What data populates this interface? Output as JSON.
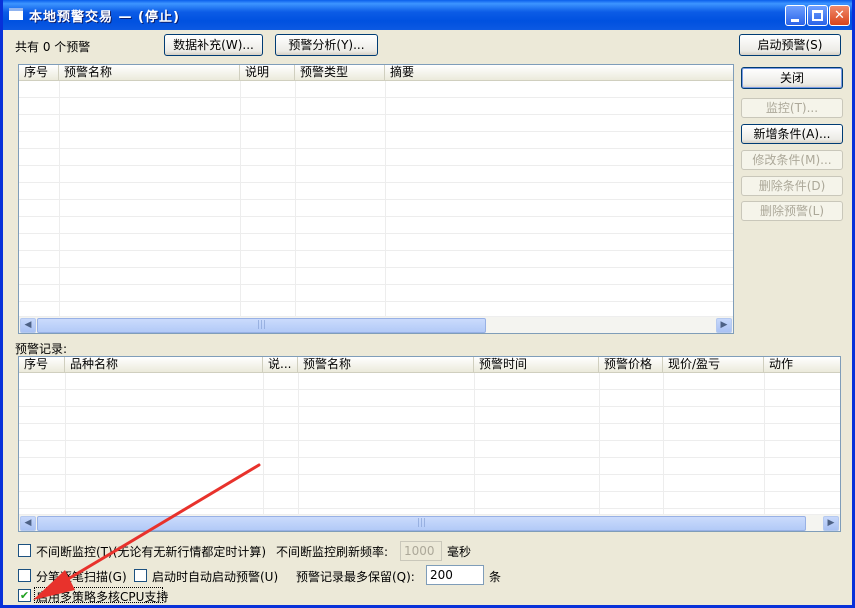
{
  "window": {
    "title": "本地预警交易 — (停止)",
    "min_glyph": "",
    "max_glyph": "",
    "close_glyph": "✕"
  },
  "top": {
    "count_text": "共有 0 个预警",
    "data_fill_button": "数据补充(W)...",
    "analysis_button": "预警分析(Y)...",
    "start_button": "启动预警(S)"
  },
  "side_buttons": {
    "close": "关闭",
    "monitor": "监控(T)...",
    "add_condition": "新增条件(A)...",
    "edit_condition": "修改条件(M)...",
    "delete_condition": "删除条件(D)",
    "delete_alert": "删除预警(L)"
  },
  "alerts_table": {
    "columns": [
      "序号",
      "预警名称",
      "说明",
      "预警类型",
      "摘要"
    ]
  },
  "records": {
    "label": "预警记录:",
    "columns": [
      "序号",
      "品种名称",
      "说...",
      "预警名称",
      "预警时间",
      "预警价格",
      "现价/盈亏",
      "动作"
    ]
  },
  "options": {
    "continuous_monitor": {
      "label": "不间断监控(T)(无论有无新行情都定时计算)",
      "checked": false
    },
    "refresh_label": "不间断监控刷新频率:",
    "refresh_value": "1000",
    "refresh_unit": "毫秒",
    "tick_scan": {
      "label": "分笔逐笔扫描(G)",
      "checked": false
    },
    "auto_start": {
      "label": "启动时自动启动预警(U)",
      "checked": false
    },
    "keep_label": "预警记录最多保留(Q):",
    "keep_value": "200",
    "keep_unit": "条",
    "multicore": {
      "label": "启用多策略多核CPU支持",
      "checked": true
    }
  },
  "scroll": {
    "left": "◀",
    "right": "▶",
    "grip": "|||"
  },
  "colors": {
    "title_blue": "#0054E3",
    "window_bg": "#ECE9D8",
    "annotation_arrow": "#E8322C"
  }
}
